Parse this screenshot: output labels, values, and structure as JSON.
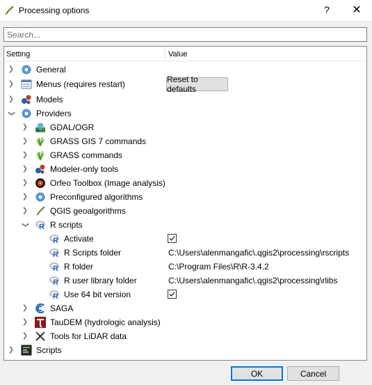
{
  "window": {
    "title": "Processing options",
    "help_glyph": "?",
    "close_glyph": "✕"
  },
  "search": {
    "placeholder": "Search...",
    "value": ""
  },
  "tree": {
    "header": {
      "setting": "Setting",
      "value": "Value"
    },
    "rows": [
      {
        "label": "General",
        "icon": "gear-icon",
        "expanded": false
      },
      {
        "label": "Menus (requires restart)",
        "icon": "menu-icon",
        "expanded": false,
        "button": "Reset to defaults"
      },
      {
        "label": "Models",
        "icon": "models-icon",
        "expanded": false
      },
      {
        "label": "Providers",
        "icon": "gear-icon",
        "expanded": true
      },
      {
        "label": "GDAL/OGR",
        "icon": "gdal-icon",
        "expanded": false
      },
      {
        "label": "GRASS GIS 7 commands",
        "icon": "grass-icon",
        "expanded": false
      },
      {
        "label": "GRASS commands",
        "icon": "grass-icon",
        "expanded": false
      },
      {
        "label": "Modeler-only tools",
        "icon": "models-icon",
        "expanded": false
      },
      {
        "label": "Orfeo Toolbox (Image analysis)",
        "icon": "otb-icon",
        "expanded": false
      },
      {
        "label": "Preconfigured algorithms",
        "icon": "gear-icon",
        "expanded": false
      },
      {
        "label": "QGIS geoalgorithms",
        "icon": "qgis-icon",
        "expanded": false
      },
      {
        "label": "R scripts",
        "icon": "r-icon",
        "expanded": true
      },
      {
        "label": "Activate",
        "icon": "r-icon",
        "checked": true
      },
      {
        "label": "R Scripts folder",
        "icon": "r-icon",
        "value": "C:\\Users\\alenmangafic\\.qgis2\\processing\\rscripts"
      },
      {
        "label": "R folder",
        "icon": "r-icon",
        "value": "C:\\Program Files\\R\\R-3.4.2"
      },
      {
        "label": "R user library folder",
        "icon": "r-icon",
        "value": "C:\\Users\\alenmangafic\\.qgis2\\processing\\rlibs"
      },
      {
        "label": "Use 64 bit version",
        "icon": "r-icon",
        "checked": true
      },
      {
        "label": "SAGA",
        "icon": "saga-icon",
        "expanded": false
      },
      {
        "label": "TauDEM (hydrologic analysis)",
        "icon": "taudem-icon",
        "expanded": false
      },
      {
        "label": "Tools for LiDAR data",
        "icon": "lidar-icon",
        "expanded": false
      },
      {
        "label": "Scripts",
        "icon": "scripts-icon",
        "expanded": false
      }
    ]
  },
  "buttons": {
    "ok": "OK",
    "cancel": "Cancel"
  },
  "colors": {
    "accent": "#0078d7",
    "r_blue": "#2266b8",
    "gear_blue": "#3d7fc9"
  }
}
